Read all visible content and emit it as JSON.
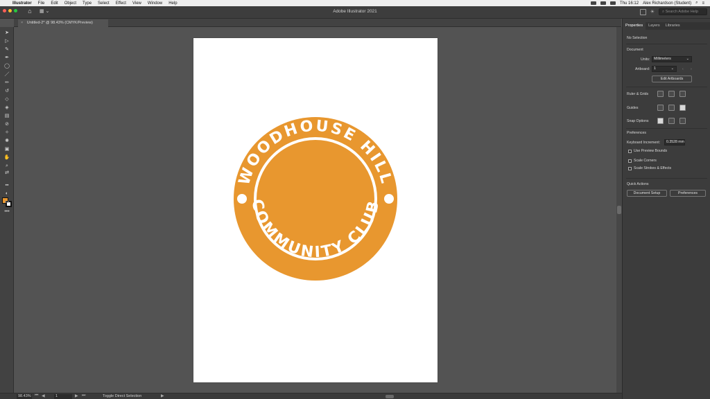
{
  "menubar": {
    "app": "Illustrator",
    "items": [
      "File",
      "Edit",
      "Object",
      "Type",
      "Select",
      "Effect",
      "View",
      "Window",
      "Help"
    ],
    "clock": "Thu 16:12",
    "user": "Alex Richardson (Student)"
  },
  "appbar": {
    "title": "Adobe Illustrator 2021",
    "search_placeholder": "Search Adobe Help"
  },
  "document_tab": {
    "label": "Untitled-2* @ 98.43% (CMYK/Preview)"
  },
  "logo": {
    "top_text": "WOODHOUSE HILL",
    "bottom_text": "COMMUNITY CLUB",
    "color": "#E8972F"
  },
  "status": {
    "zoom": "98.43%",
    "page": "1",
    "text": "Toggle Direct Selection"
  },
  "panel": {
    "tabs": [
      "Properties",
      "Layers",
      "Libraries"
    ],
    "selection": "No Selection",
    "document_heading": "Document",
    "units_label": "Units:",
    "units_value": "Millimeters",
    "artboard_label": "Artboard:",
    "artboard_value": "1",
    "edit_artboards": "Edit Artboards",
    "ruler_grids": "Ruler & Grids",
    "guides": "Guides",
    "snap_options": "Snap Options",
    "preferences_heading": "Preferences",
    "keyboard_increment_label": "Keyboard Increment:",
    "keyboard_increment_value": "0.3528 mm",
    "use_preview_bounds": "Use Preview Bounds",
    "scale_corners": "Scale Corners",
    "scale_strokes": "Scale Strokes & Effects",
    "quick_actions": "Quick Actions",
    "document_setup": "Document Setup",
    "preferences_button": "Preferences"
  }
}
